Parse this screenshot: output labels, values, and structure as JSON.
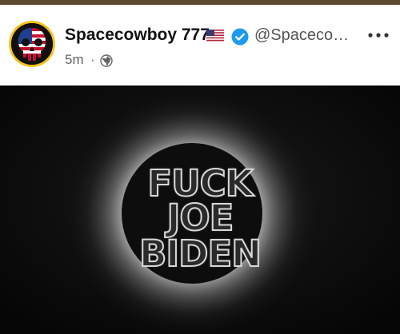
{
  "post": {
    "author_name": "Spacecowboy 777",
    "handle": "@Spaceco…",
    "time": "5m",
    "separator": "·",
    "flag_icon": "us-flag-icon",
    "verified_icon": "verified-badge-icon",
    "visibility_icon": "globe-icon",
    "more_icon": "more-options-icon"
  },
  "media": {
    "text_lines": [
      "FUCK",
      "JOE",
      "BIDEN"
    ]
  },
  "colors": {
    "avatar_ring": "#f4c21b",
    "verified_blue": "#1d9bf0",
    "top_bar": "#5c4a2e"
  }
}
